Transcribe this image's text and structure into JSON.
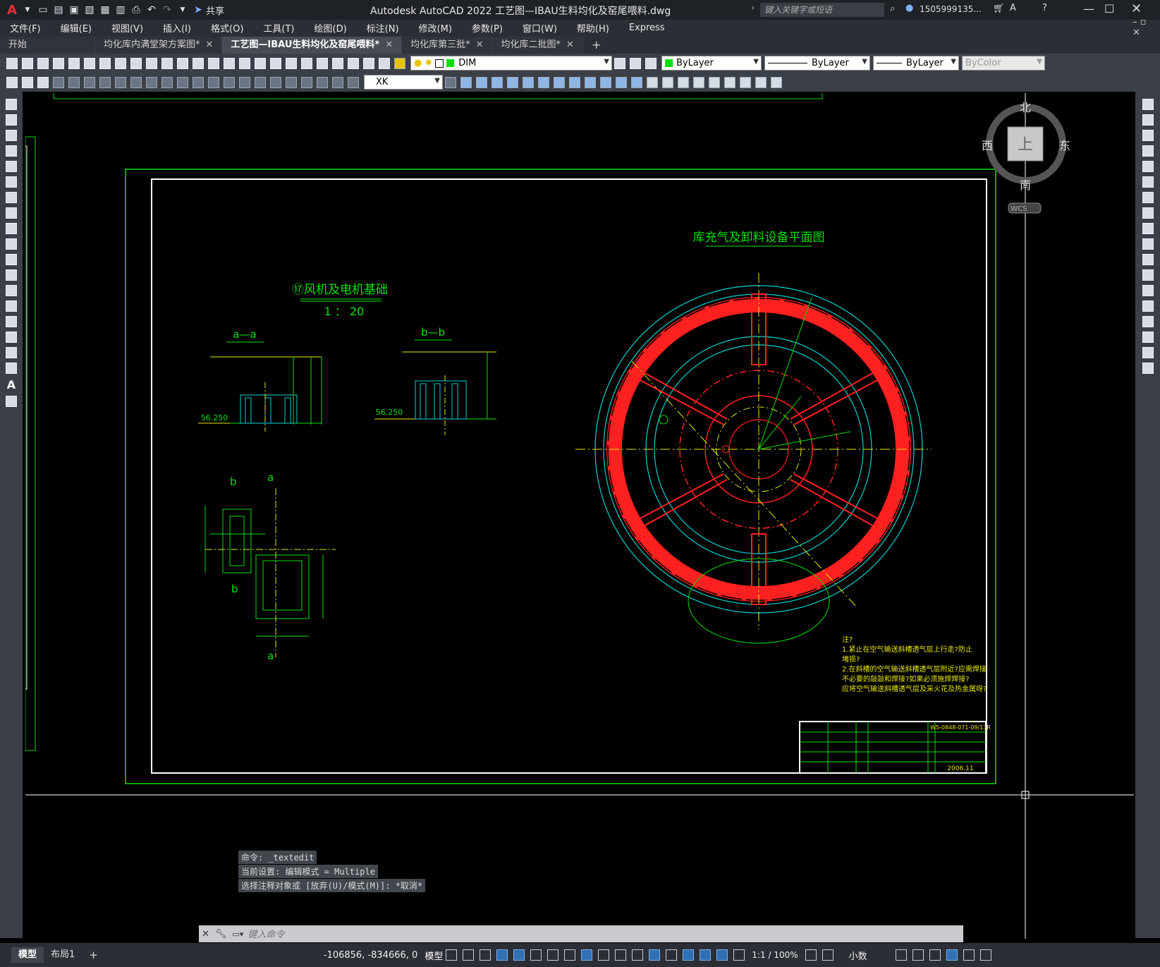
{
  "window": {
    "title": "Autodesk AutoCAD 2022    工艺图—IBAU生料均化及窑尾喂料.dwg",
    "share_label": "共享",
    "search_placeholder": "键入关键字或短语",
    "user": "1505999135..."
  },
  "menu": [
    "文件(F)",
    "编辑(E)",
    "视图(V)",
    "插入(I)",
    "格式(O)",
    "工具(T)",
    "绘图(D)",
    "标注(N)",
    "修改(M)",
    "参数(P)",
    "窗口(W)",
    "帮助(H)",
    "Express"
  ],
  "doc_tabs": [
    {
      "label": "开始",
      "closable": false
    },
    {
      "label": "均化库内满堂架方案图*",
      "closable": true
    },
    {
      "label": "工艺图—IBAU生料均化及窑尾喂料*",
      "closable": true,
      "active": true
    },
    {
      "label": "均化库第三批*",
      "closable": true
    },
    {
      "label": "均化库二批图*",
      "closable": true
    }
  ],
  "toolbar1": {
    "layer": "DIM",
    "color": "ByLayer",
    "linetype": "ByLayer",
    "lineweight": "ByLayer",
    "plotstyle": "ByColor"
  },
  "toolbar2": {
    "dimstyle": "XK"
  },
  "viewcube": {
    "north": "北",
    "south": "南",
    "east": "东",
    "west": "西",
    "top": "上",
    "wcs": "WCS"
  },
  "drawing": {
    "plan_title": "库充气及卸料设备平面图",
    "fan_title": "⑰风机及电机基础",
    "scale": "1 ： 20",
    "section_a": "a—a",
    "section_b": "b—b",
    "elev_a": "56.250",
    "elev_b": "56.250",
    "mark_b_top": "b",
    "mark_a_top": "a",
    "mark_b_mid": "b",
    "mark_a_bot": "a",
    "notes": [
      "注?",
      "1.紧止在空气输送斜槽透气层上行走?防止",
      "   堵损?",
      "2.在斜槽的空气输送斜槽透气层附近?应需焊接",
      "   不必要的敲敲和焊接?如果必须施焊焊接?",
      "   应将空气输送斜槽透气层及采火花及热金属呀?"
    ],
    "titleblock_date": "2006.11",
    "titleblock_no": "W5-0848-071-09/13R"
  },
  "command": {
    "history": [
      "命令: _textedit",
      "当前设置: 编辑模式 = Multiple",
      "选择注释对象或 [放弃(U)/模式(M)]: *取消*"
    ],
    "placeholder": "键入命令"
  },
  "layout_tabs": [
    "模型",
    "布局1"
  ],
  "status": {
    "coords": "-106856, -834666, 0",
    "model": "模型",
    "scale": "1:1 / 100%",
    "units": "小数"
  },
  "colors": {
    "green": "#00e000",
    "red": "#ff2020",
    "cyan": "#00d0d0",
    "yellow": "#e8e800",
    "white": "#ffffff"
  }
}
